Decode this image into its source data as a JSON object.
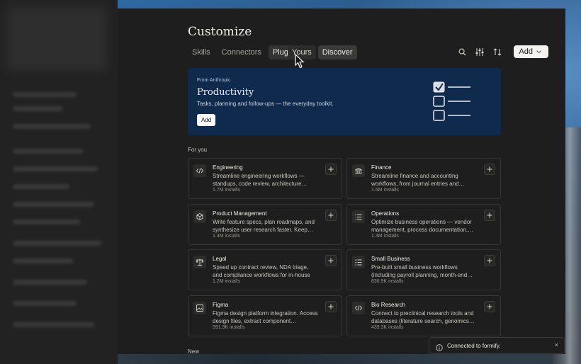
{
  "header": {
    "title": "Customize"
  },
  "tabs": [
    {
      "label": "Skills",
      "active": false
    },
    {
      "label": "Connectors",
      "active": false
    },
    {
      "label": "Plugins",
      "active": true
    }
  ],
  "subtabs": [
    {
      "label": "Yours",
      "selected": false
    },
    {
      "label": "Discover",
      "selected": true
    }
  ],
  "toolbar": {
    "icons": [
      "search-icon",
      "filter-sliders-icon",
      "sort-icon"
    ],
    "add_label": "Add"
  },
  "banner": {
    "from": "From Anthropic",
    "title": "Productivity",
    "description": "Tasks, planning and follow-ups — the everyday toolkit.",
    "add_label": "Add",
    "background": "#0f2a4d"
  },
  "sections": {
    "for_you": "For you",
    "new": "New"
  },
  "cards": [
    {
      "name": "Engineering",
      "description": "Streamline engineering workflows — standups, code review, architecture…",
      "installs": "1.7M installs",
      "icon": "code-icon"
    },
    {
      "name": "Finance",
      "description": "Streamline finance and accounting workflows, from journal entries and…",
      "installs": "1.6M installs",
      "icon": "bank-icon"
    },
    {
      "name": "Product Management",
      "description": "Write feature specs, plan roadmaps, and synthesize user research faster. Keep…",
      "installs": "1.4M installs",
      "icon": "cube-icon"
    },
    {
      "name": "Operations",
      "description": "Optimize business operations — vendor management, process documentation,…",
      "installs": "1.3M installs",
      "icon": "list-icon"
    },
    {
      "name": "Legal",
      "description": "Speed up contract review, NDA triage, and compliance workflows for in-house legal…",
      "installs": "1.2M installs",
      "icon": "scales-icon"
    },
    {
      "name": "Small Business",
      "description": "Pre-built small business workflows (including payroll planning, month-end…",
      "installs": "836.9K installs",
      "icon": "checklist-icon"
    },
    {
      "name": "Figma",
      "description": "Figma design platform integration. Access design files, extract component…",
      "installs": "591.9K installs",
      "icon": "image-icon"
    },
    {
      "name": "Bio Research",
      "description": "Connect to preclinical research tools and databases (literature search, genomics…",
      "installs": "439.3K installs",
      "icon": "code-icon"
    }
  ],
  "toast": {
    "text": "Connected to formify.",
    "close": "×"
  }
}
